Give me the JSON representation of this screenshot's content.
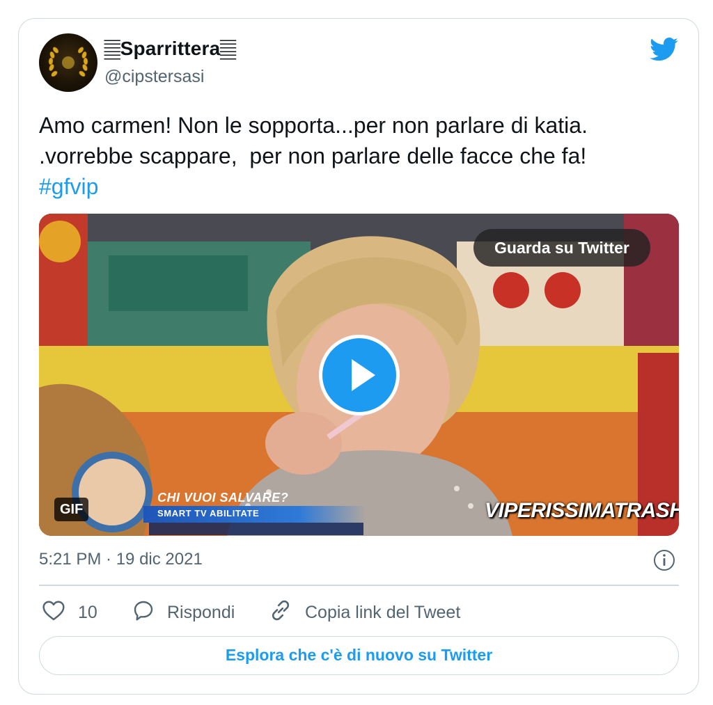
{
  "user": {
    "display_name": "𝄛Sparrittera𝄛",
    "handle": "@cipstersasi"
  },
  "tweet": {
    "text": "Amo carmen! Non le sopporta...per non parlare di katia.\n.vorrebbe scappare,  per non parlare delle facce che fa!\n",
    "hashtag": "#gfvip",
    "timestamp": "5:21 PM · 19 dic 2021"
  },
  "media": {
    "watch_label": "Guarda su Twitter",
    "gif_badge": "GIF",
    "chyron_title": "CHI VUOI SALVARE?",
    "chyron_sub": "SMART TV ABILITATE",
    "watermark": "VIPERISSIMATRASH"
  },
  "actions": {
    "like_count": "10",
    "reply_label": "Rispondi",
    "copy_label": "Copia link del Tweet"
  },
  "footer": {
    "explore_label": "Esplora che c'è di nuovo su Twitter"
  },
  "colors": {
    "accent": "#1d9bf0",
    "muted": "#536471",
    "border": "#cfd9de"
  },
  "icons": [
    "twitter-bird-icon",
    "play-icon",
    "info-icon",
    "heart-icon",
    "reply-bubble-icon",
    "link-icon"
  ]
}
